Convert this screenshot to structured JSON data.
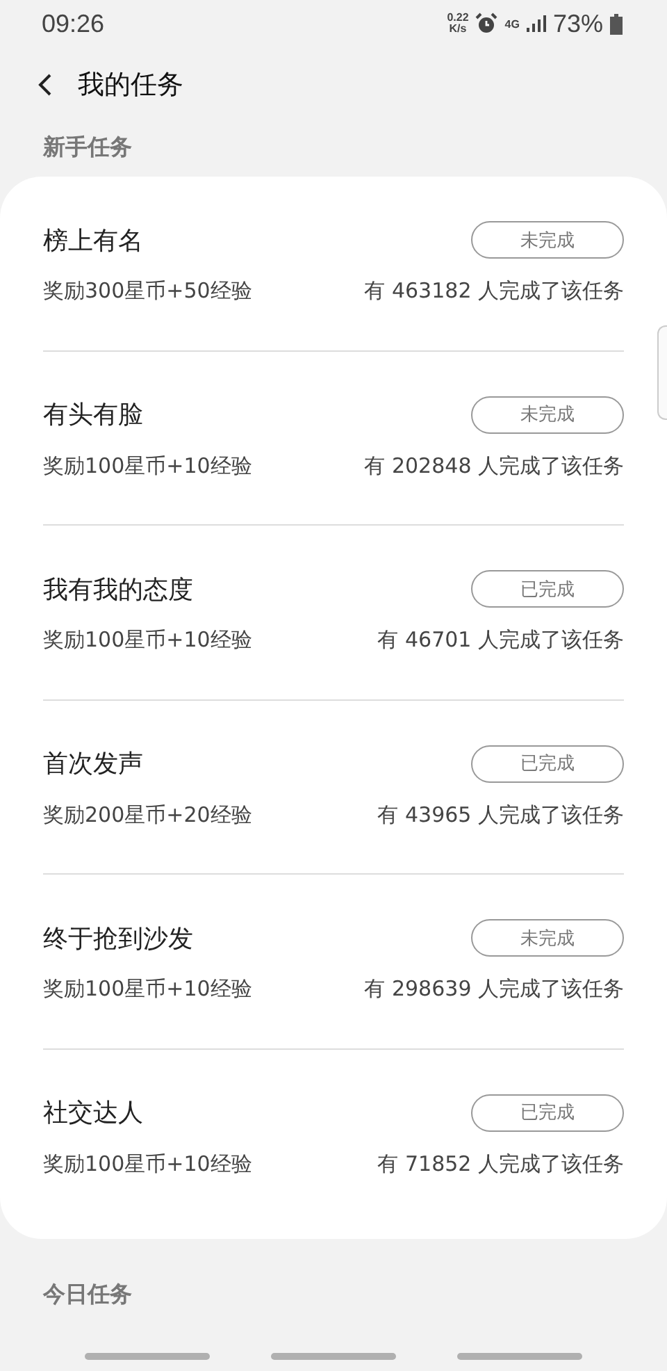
{
  "status_bar": {
    "time": "09:26",
    "speed_value": "0.22",
    "speed_unit": "K/s",
    "network": "4G",
    "battery": "73%"
  },
  "header": {
    "title": "我的任务"
  },
  "sections": [
    {
      "title": "新手任务",
      "tasks": [
        {
          "name": "榜上有名",
          "status": "未完成",
          "reward": "奖励300星币+50经验",
          "completed_by": "有 463182 人完成了该任务"
        },
        {
          "name": "有头有脸",
          "status": "未完成",
          "reward": "奖励100星币+10经验",
          "completed_by": "有 202848 人完成了该任务"
        },
        {
          "name": "我有我的态度",
          "status": "已完成",
          "reward": "奖励100星币+10经验",
          "completed_by": "有 46701 人完成了该任务"
        },
        {
          "name": "首次发声",
          "status": "已完成",
          "reward": "奖励200星币+20经验",
          "completed_by": "有 43965 人完成了该任务"
        },
        {
          "name": "终于抢到沙发",
          "status": "未完成",
          "reward": "奖励100星币+10经验",
          "completed_by": "有 298639 人完成了该任务"
        },
        {
          "name": "社交达人",
          "status": "已完成",
          "reward": "奖励100星币+10经验",
          "completed_by": "有 71852 人完成了该任务"
        }
      ]
    },
    {
      "title": "今日任务"
    }
  ]
}
